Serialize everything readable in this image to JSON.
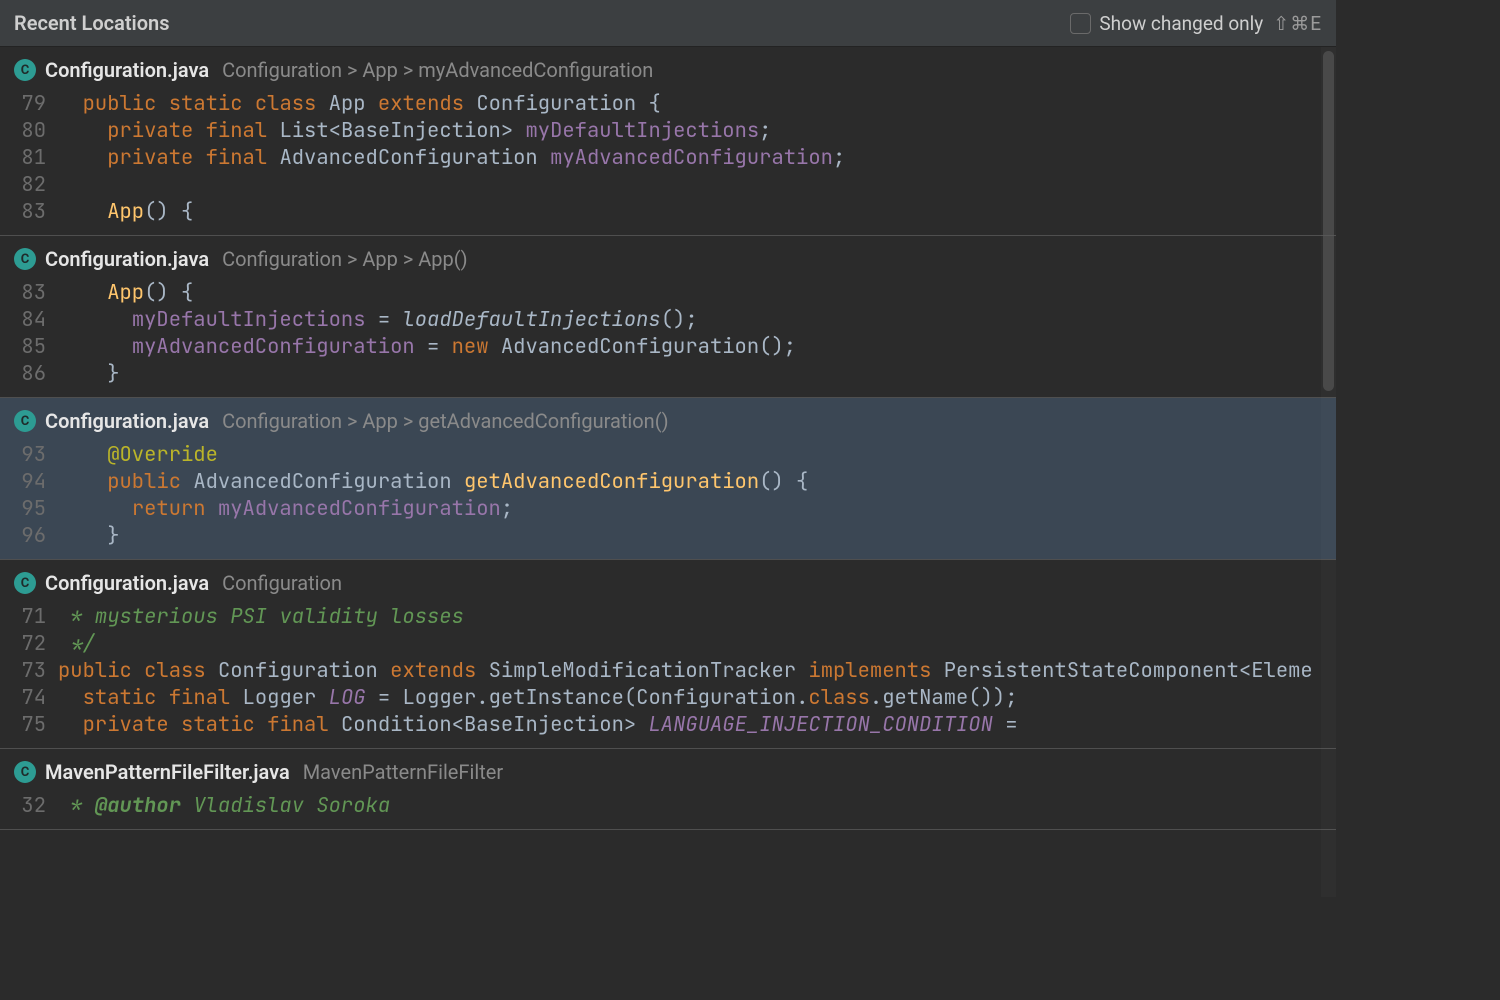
{
  "header": {
    "title": "Recent Locations",
    "checkbox_label": "Show changed only",
    "shortcut": "⇧⌘E"
  },
  "entries": [
    {
      "icon": "C",
      "file": "Configuration.java",
      "breadcrumb": "Configuration > App > myAdvancedConfiguration",
      "selected": false,
      "lines": [
        {
          "n": "79",
          "html": "  <span class='kw'>public</span> <span class='kw'>static</span> <span class='kw'>class</span> <span class='type'>App</span> <span class='kw'>extends</span> <span class='type'>Configuration</span> {"
        },
        {
          "n": "80",
          "html": "    <span class='kw'>private</span> <span class='kw'>final</span> <span class='type'>List</span>&lt;<span class='type'>BaseInjection</span>&gt; <span class='field'>myDefaultInjections</span>;"
        },
        {
          "n": "81",
          "html": "    <span class='kw'>private</span> <span class='kw'>final</span> <span class='type'>AdvancedConfiguration</span> <span class='field'>myAdvancedConfiguration</span>;"
        },
        {
          "n": "82",
          "html": ""
        },
        {
          "n": "83",
          "html": "    <span class='fn'>App</span>() {"
        }
      ]
    },
    {
      "icon": "C",
      "file": "Configuration.java",
      "breadcrumb": "Configuration > App > App()",
      "selected": false,
      "lines": [
        {
          "n": "83",
          "html": "    <span class='fn'>App</span>() {"
        },
        {
          "n": "84",
          "html": "      <span class='field'>myDefaultInjections</span> = <span style='font-style:italic'>loadDefaultInjections</span>();"
        },
        {
          "n": "85",
          "html": "      <span class='field'>myAdvancedConfiguration</span> = <span class='kw'>new</span> <span class='type'>AdvancedConfiguration</span>();"
        },
        {
          "n": "86",
          "html": "    }"
        }
      ]
    },
    {
      "icon": "C",
      "file": "Configuration.java",
      "breadcrumb": "Configuration > App > getAdvancedConfiguration()",
      "selected": true,
      "lines": [
        {
          "n": "93",
          "html": "    <span class='ann'>@Override</span>"
        },
        {
          "n": "94",
          "html": "    <span class='kw'>public</span> <span class='type'>AdvancedConfiguration</span> <span class='fn'>getAdvancedConfiguration</span>() {"
        },
        {
          "n": "95",
          "html": "      <span class='kw'>return</span> <span class='field'>myAdvancedConfiguration</span>;"
        },
        {
          "n": "96",
          "html": "    }"
        }
      ]
    },
    {
      "icon": "C",
      "file": "Configuration.java",
      "breadcrumb": "Configuration",
      "selected": false,
      "lines": [
        {
          "n": "71",
          "html": " <span class='cmt'>* mysterious PSI validity losses</span>"
        },
        {
          "n": "72",
          "html": " <span class='cmt'>*/</span>"
        },
        {
          "n": "73",
          "html": "<span class='kw'>public</span> <span class='kw'>class</span> <span class='type'>Configuration</span> <span class='kw'>extends</span> <span class='type'>SimpleModificationTracker</span> <span class='kw'>implements</span> <span class='type'>PersistentStateComponent</span>&lt;<span class='type'>Eleme</span>"
        },
        {
          "n": "74",
          "html": "  <span class='kw'>static</span> <span class='kw'>final</span> <span class='type'>Logger</span> <span class='const'>LOG</span> = Logger.getInstance(Configuration.<span class='kw'>class</span>.getName());"
        },
        {
          "n": "75",
          "html": "  <span class='kw'>private</span> <span class='kw'>static</span> <span class='kw'>final</span> <span class='type'>Condition</span>&lt;<span class='type'>BaseInjection</span>&gt; <span class='const'>LANGUAGE_INJECTION_CONDITION</span> ="
        }
      ]
    },
    {
      "icon": "C",
      "file": "MavenPatternFileFilter.java",
      "breadcrumb": "MavenPatternFileFilter",
      "selected": false,
      "lines": [
        {
          "n": "32",
          "html": " <span class='cmt'>* <span class='doctag'>@author</span> Vladislav Soroka</span>"
        }
      ]
    }
  ]
}
